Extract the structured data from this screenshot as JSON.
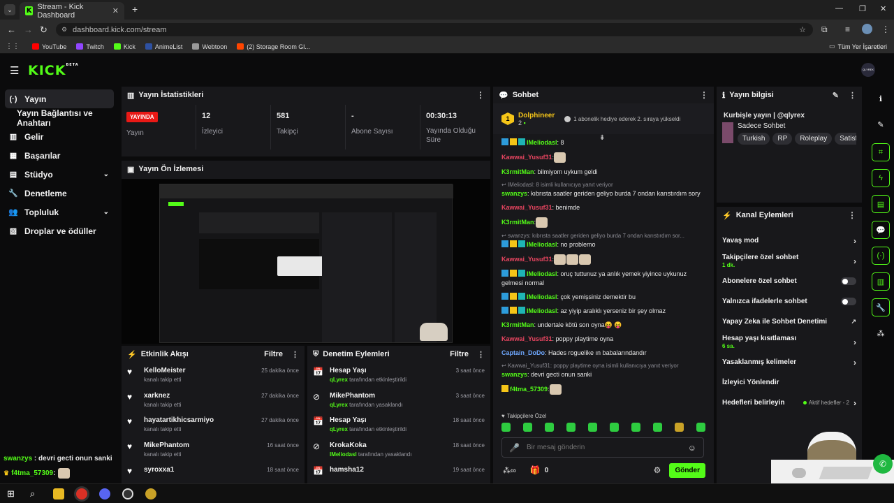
{
  "browser": {
    "tab_title": "Stream - Kick Dashboard",
    "url": "dashboard.kick.com/stream",
    "bookmarks": [
      {
        "label": "YouTube",
        "color": "#ff0000"
      },
      {
        "label": "Twitch",
        "color": "#9146ff"
      },
      {
        "label": "Kick",
        "color": "#53fc18"
      },
      {
        "label": "AnimeList",
        "color": "#2e51a2"
      },
      {
        "label": "Webtoon",
        "color": "#999999"
      },
      {
        "label": "(2) Storage Room Gl...",
        "color": "#ff4500"
      }
    ],
    "all_bookmarks": "Tüm Yer İşaretleri"
  },
  "header": {
    "logo": "KICK",
    "logo_tag": "BETA",
    "avatar": "QLYREX"
  },
  "sidebar": {
    "items": [
      {
        "label": "Yayın",
        "icon": "(·)"
      },
      {
        "label": "Yayın Bağlantısı ve Anahtarı",
        "icon": ""
      },
      {
        "label": "Gelir",
        "icon": "▥"
      },
      {
        "label": "Başarılar",
        "icon": "▦"
      },
      {
        "label": "Stüdyo",
        "icon": "▤"
      },
      {
        "label": "Denetleme",
        "icon": "🔧"
      },
      {
        "label": "Topluluk",
        "icon": "👥"
      },
      {
        "label": "Droplar ve ödüller",
        "icon": "▨"
      }
    ]
  },
  "stats": {
    "title": "Yayın İstatistikleri",
    "live_badge": "YAYINDA",
    "live_label": "Yayın",
    "items": [
      {
        "value": "12",
        "label": "İzleyici"
      },
      {
        "value": "581",
        "label": "Takipçi"
      },
      {
        "value": "-",
        "label": "Abone Sayısı"
      },
      {
        "value": "00:30:13",
        "label": "Yayında Olduğu Süre"
      }
    ]
  },
  "preview": {
    "title": "Yayın Ön İzlemesi"
  },
  "activity": {
    "title": "Etkinlik Akışı",
    "filter": "Filtre",
    "items": [
      {
        "name": "KelloMeister",
        "sub": "kanalı takip etti",
        "time": "25 dakika önce"
      },
      {
        "name": "xarknez",
        "sub": "kanalı takip etti",
        "time": "27 dakika önce"
      },
      {
        "name": "hayatartikhicsarmiyo",
        "sub": "kanalı takip etti",
        "time": "27 dakika önce"
      },
      {
        "name": "MikePhantom",
        "sub": "kanalı takip etti",
        "time": "16 saat önce"
      },
      {
        "name": "syroxxa1",
        "sub": "",
        "time": "18 saat önce"
      }
    ]
  },
  "moderation": {
    "title": "Denetim Eylemleri",
    "filter": "Filtre",
    "items": [
      {
        "name": "Hesap Yaşı",
        "actor": "qLyrex",
        "sub": "tarafından etkinleştirildi",
        "time": "3 saat önce",
        "icon": "📅"
      },
      {
        "name": "MikePhantom",
        "actor": "qLyrex",
        "sub": "tarafından yasaklandı",
        "time": "3 saat önce",
        "icon": "⊘"
      },
      {
        "name": "Hesap Yaşı",
        "actor": "qLyrex",
        "sub": "tarafından etkinleştirildi",
        "time": "18 saat önce",
        "icon": "📅"
      },
      {
        "name": "KrokaKoka",
        "actor": "IMeliodasl",
        "sub": "tarafından yasaklandı",
        "time": "18 saat önce",
        "icon": "⊘"
      },
      {
        "name": "hamsha12",
        "actor": "",
        "sub": "",
        "time": "19 saat önce",
        "icon": "📅"
      }
    ]
  },
  "chat": {
    "title": "Sohbet",
    "pinned_user": "Dolphineer",
    "pinned_count": "2",
    "pinned_rank": "1",
    "pinned_text": "1 abonelik hediye ederek 2. sıraya yükseldi",
    "messages": [
      {
        "type": "msg",
        "user": "IMeliodasl",
        "color": "#53fc18",
        "text": ": 8",
        "badges": true
      },
      {
        "type": "msg",
        "user": "Kawwai_Yusuf31",
        "color": "#e94560",
        "text": ":",
        "emotes": 1
      },
      {
        "type": "msg",
        "user": "K3rmitMan",
        "color": "#53fc18",
        "text": ": bilmiyom uykum geldi"
      },
      {
        "type": "reply",
        "text": "IMeliodasl: 8 isimli kullanıcıya yanıt veriyor"
      },
      {
        "type": "msg",
        "user": "swanzys",
        "color": "#53fc18",
        "text": ": kıbrısta saatler geriden geliyo burda 7 ondan karıstırdım sory"
      },
      {
        "type": "msg",
        "user": "Kawwai_Yusuf31",
        "color": "#e94560",
        "text": ": benimde"
      },
      {
        "type": "msg",
        "user": "K3rmitMan",
        "color": "#53fc18",
        "text": ":",
        "emotes": 1
      },
      {
        "type": "reply",
        "text": "swanzys: kıbrısta saatler geriden geliyo burda 7 ondan karıstırdım sor..."
      },
      {
        "type": "msg",
        "user": "IMeliodasl",
        "color": "#53fc18",
        "text": ": no problemo",
        "badges": true
      },
      {
        "type": "msg",
        "user": "Kawwai_Yusuf31",
        "color": "#e94560",
        "text": ":",
        "emotes": 3
      },
      {
        "type": "msg",
        "user": "IMeliodasl",
        "color": "#53fc18",
        "text": ": oruç tuttunuz ya anlık yemek yiyince uykunuz gelmesi normal",
        "badges": true
      },
      {
        "type": "msg",
        "user": "IMeliodasl",
        "color": "#53fc18",
        "text": ": çok yemişsiniz demektir bu",
        "badges": true
      },
      {
        "type": "msg",
        "user": "IMeliodasl",
        "color": "#53fc18",
        "text": ": az yiyip aralıklı yerseniz bir şey olmaz",
        "badges": true
      },
      {
        "type": "msg",
        "user": "K3rmitMan",
        "color": "#53fc18",
        "text": ": undertale kötü son oyna😝 😝"
      },
      {
        "type": "msg",
        "user": "Kawwai_Yusuf31",
        "color": "#e94560",
        "text": ": poppy playtime oyna"
      },
      {
        "type": "msg",
        "user": "Captain_DoDo",
        "color": "#6fa8ff",
        "text": ": Hades roguelike ın babalarındandır"
      },
      {
        "type": "reply",
        "text": "Kawwai_Yusuf31: poppy playtime oyna isimli kullanıcıya yanıt veriyor"
      },
      {
        "type": "msg",
        "user": "swanzys",
        "color": "#53fc18",
        "text": ": devri gecti onun sanki"
      },
      {
        "type": "msg",
        "user": "f4tma_57309",
        "color": "#53fc18",
        "text": ":",
        "emotes": 1,
        "crown": true
      }
    ],
    "followers_only": "Takipçilere Özel",
    "input_placeholder": "Bir mesaj gönderin",
    "points": "0",
    "send": "Gönder"
  },
  "stream_info": {
    "title": "Yayın bilgisi",
    "stream_title": "Kurbişle yayın | @qlyrex",
    "category": "Sadece Sohbet",
    "tags": [
      "Turkish",
      "RP",
      "Roleplay",
      "Satisf"
    ]
  },
  "channel_actions": {
    "title": "Kanal Eylemleri",
    "items": [
      {
        "label": "Yavaş mod",
        "sub": "",
        "control": "chevron"
      },
      {
        "label": "Takipçilere özel sohbet",
        "sub": "1 dk.",
        "control": "chevron"
      },
      {
        "label": "Abonelere özel sohbet",
        "sub": "",
        "control": "toggle"
      },
      {
        "label": "Yalnızca ifadelerle sohbet",
        "sub": "",
        "control": "toggle"
      },
      {
        "label": "Yapay Zeka ile Sohbet Denetimi",
        "sub": "",
        "control": "external"
      },
      {
        "label": "Hesap yaşı kısıtlaması",
        "sub": "6 sa.",
        "control": "chevron"
      },
      {
        "label": "Yasaklanmış kelimeler",
        "sub": "",
        "control": "chevron"
      },
      {
        "label": "İzleyici Yönlendir",
        "sub": "",
        "control": "none"
      },
      {
        "label": "Hedefleri belirleyin",
        "sub": "",
        "control": "goals",
        "extra": "Aktif hedefler - 2"
      }
    ]
  },
  "overlay": {
    "lines": [
      {
        "user": "swanzys",
        "text": " : devri gecti onun sanki"
      },
      {
        "user": "f4tma_57309",
        "text": " :"
      }
    ]
  },
  "colors": {
    "accent": "#53fc18",
    "panel": "#18181b",
    "bg": "#0b0b0c",
    "live": "#e91916"
  }
}
